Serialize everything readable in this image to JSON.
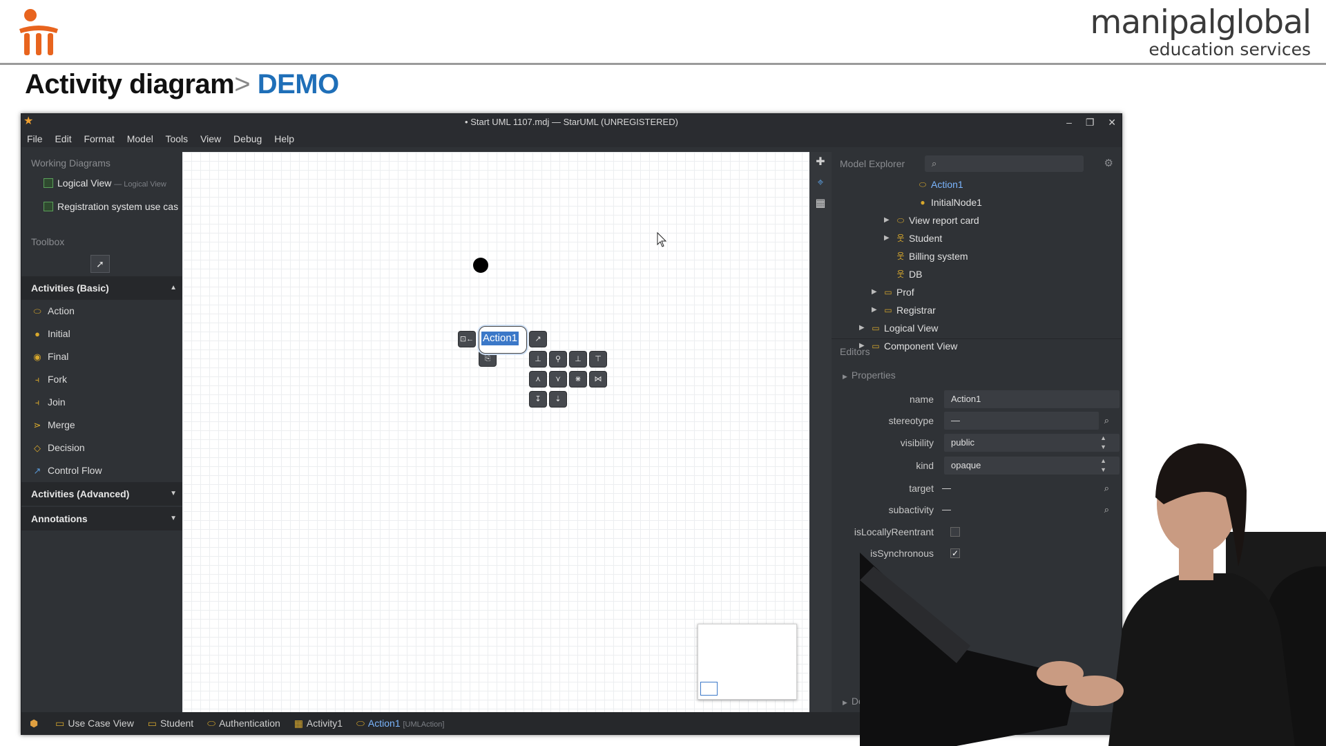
{
  "brand": {
    "name_line1": "manipalglobal",
    "name_line2": "education services",
    "logo_color": "#e8641e"
  },
  "slide": {
    "title": "Activity diagram",
    "separator": ">",
    "demo": "DEMO"
  },
  "window": {
    "title": "• Start UML 1107.mdj — StarUML (UNREGISTERED)",
    "menu": [
      "File",
      "Edit",
      "Format",
      "Model",
      "Tools",
      "View",
      "Debug",
      "Help"
    ]
  },
  "working_diagrams": {
    "header": "Working Diagrams",
    "items": [
      {
        "label": "Logical View",
        "sub": "— Logical View"
      },
      {
        "label": "Registration system use cas",
        "sub": ""
      }
    ]
  },
  "toolbox": {
    "header": "Toolbox",
    "groups": [
      {
        "label": "Activities (Basic)"
      },
      {
        "label": "Activities (Advanced)"
      },
      {
        "label": "Annotations"
      }
    ],
    "items": [
      "Action",
      "Initial",
      "Final",
      "Fork",
      "Join",
      "Merge",
      "Decision",
      "Control Flow"
    ]
  },
  "canvas": {
    "action_label": "Action1"
  },
  "model_explorer": {
    "header": "Model Explorer",
    "search_placeholder": "",
    "items": [
      {
        "label": "Action1",
        "icon": "action-icon",
        "selected": true
      },
      {
        "label": "InitialNode1",
        "icon": "initial-node-icon"
      },
      {
        "label": "View report card",
        "icon": "usecase-icon"
      },
      {
        "label": "Student",
        "icon": "actor-icon"
      },
      {
        "label": "Billing system",
        "icon": "actor-icon"
      },
      {
        "label": "DB",
        "icon": "actor-icon"
      },
      {
        "label": "Prof",
        "icon": "folder-icon"
      },
      {
        "label": "Registrar",
        "icon": "folder-icon"
      },
      {
        "label": "Logical View",
        "icon": "folder-icon"
      },
      {
        "label": "Component View",
        "icon": "folder-icon"
      }
    ]
  },
  "editors": {
    "header": "Editors",
    "properties_header": "Properties",
    "fields": {
      "name": {
        "label": "name",
        "value": "Action1"
      },
      "stereotype": {
        "label": "stereotype",
        "value": "—"
      },
      "visibility": {
        "label": "visibility",
        "value": "public"
      },
      "kind": {
        "label": "kind",
        "value": "opaque"
      },
      "target": {
        "label": "target",
        "value": "—"
      },
      "subactivity": {
        "label": "subactivity",
        "value": "—"
      },
      "isLocallyReentrant": {
        "label": "isLocallyReentrant",
        "checked": false
      },
      "isSynchronous": {
        "label": "isSynchronous",
        "checked": true
      }
    },
    "documentation_header": "Document"
  },
  "statusbar": {
    "items": [
      {
        "label": "Use Case View",
        "tag": ""
      },
      {
        "label": "Student",
        "tag": ""
      },
      {
        "label": "Authentication",
        "tag": ""
      },
      {
        "label": "Activity1",
        "tag": ""
      },
      {
        "label": "Action1",
        "tag": "[UMLAction]"
      }
    ]
  }
}
